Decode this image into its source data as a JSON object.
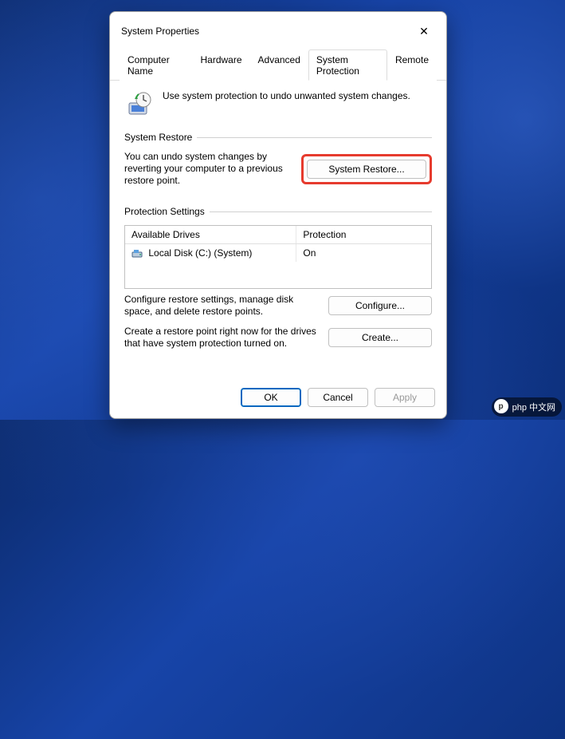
{
  "dialog": {
    "title": "System Properties",
    "close_label": "✕"
  },
  "tabs": [
    {
      "label": "Computer Name"
    },
    {
      "label": "Hardware"
    },
    {
      "label": "Advanced"
    },
    {
      "label": "System Protection"
    },
    {
      "label": "Remote"
    }
  ],
  "active_tab": "System Protection",
  "intro_text": "Use system protection to undo unwanted system changes.",
  "restore_section": {
    "legend": "System Restore",
    "desc": "You can undo system changes by reverting your computer to a previous restore point.",
    "button": "System Restore..."
  },
  "protection_section": {
    "legend": "Protection Settings",
    "columns": [
      "Available Drives",
      "Protection"
    ],
    "rows": [
      {
        "drive": "Local Disk (C:) (System)",
        "protection": "On"
      }
    ],
    "configure_desc": "Configure restore settings, manage disk space, and delete restore points.",
    "configure_button": "Configure...",
    "create_desc": "Create a restore point right now for the drives that have system protection turned on.",
    "create_button": "Create..."
  },
  "footer": {
    "ok": "OK",
    "cancel": "Cancel",
    "apply": "Apply"
  },
  "watermark": "php 中文网"
}
